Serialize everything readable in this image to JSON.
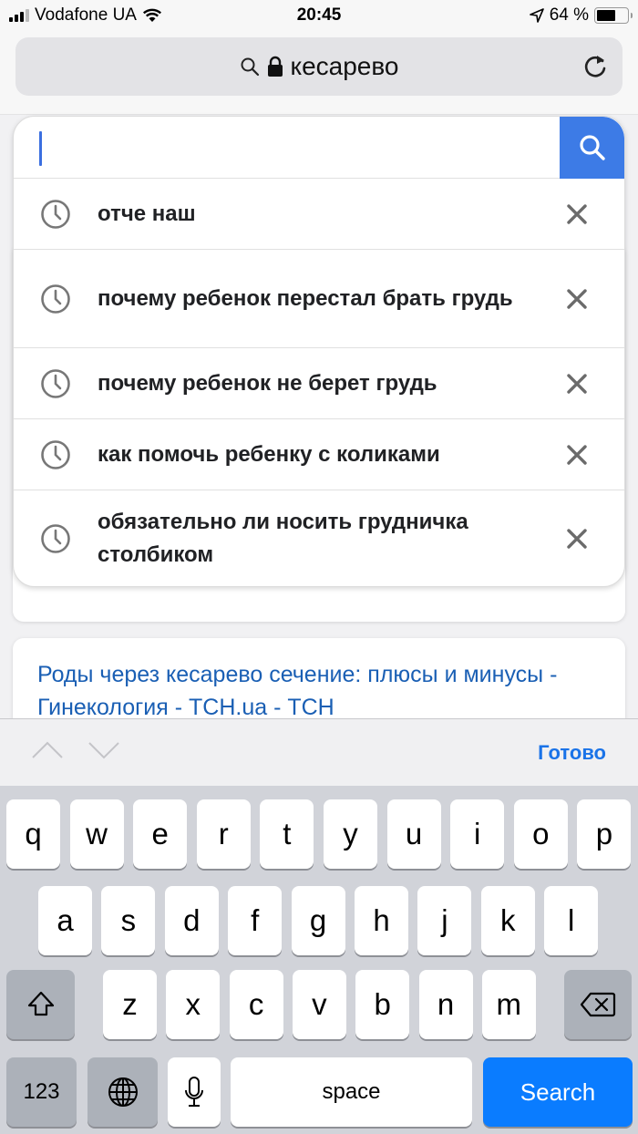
{
  "status_bar": {
    "carrier": "Vodafone UA",
    "time": "20:45",
    "battery_percent_label": "64 %",
    "battery_level": 0.64,
    "signal_bars_active": 3,
    "signal_bars_total": 4,
    "icons": [
      "signal-icon",
      "wifi-icon",
      "location-arrow-icon",
      "battery-icon"
    ]
  },
  "url_bar": {
    "query": "кесарево",
    "icons": [
      "search-icon",
      "lock-icon",
      "reload-icon"
    ]
  },
  "search_box": {
    "value": "",
    "button_icon": "search-icon",
    "accent_color": "#3d7be6"
  },
  "suggestions": [
    {
      "text": "отче наш",
      "icon": "history-clock-icon",
      "remove_icon": "close-icon"
    },
    {
      "text": "почему ребенок перестал брать грудь",
      "icon": "history-clock-icon",
      "remove_icon": "close-icon"
    },
    {
      "text": "почему ребенок не берет грудь",
      "icon": "history-clock-icon",
      "remove_icon": "close-icon"
    },
    {
      "text": "как помочь ребенку с коликами",
      "icon": "history-clock-icon",
      "remove_icon": "close-icon"
    },
    {
      "text": "обязательно ли носить грудничка столбиком",
      "icon": "history-clock-icon",
      "remove_icon": "close-icon"
    }
  ],
  "result": {
    "title": "Роды через кесарево сечение: плюсы и минусы - Гинекология - ТСН.ua - ТСН",
    "link_color": "#1a5fb4"
  },
  "accessory_bar": {
    "done_label": "Готово",
    "icons": [
      "chevron-up-icon",
      "chevron-down-icon"
    ]
  },
  "keyboard": {
    "row1": [
      "q",
      "w",
      "e",
      "r",
      "t",
      "y",
      "u",
      "i",
      "o",
      "p"
    ],
    "row2": [
      "a",
      "s",
      "d",
      "f",
      "g",
      "h",
      "j",
      "k",
      "l"
    ],
    "row3": [
      "z",
      "x",
      "c",
      "v",
      "b",
      "n",
      "m"
    ],
    "numbers_label": "123",
    "space_label": "space",
    "search_label": "Search",
    "icons": [
      "shift-icon",
      "backspace-icon",
      "globe-icon",
      "microphone-icon"
    ]
  }
}
